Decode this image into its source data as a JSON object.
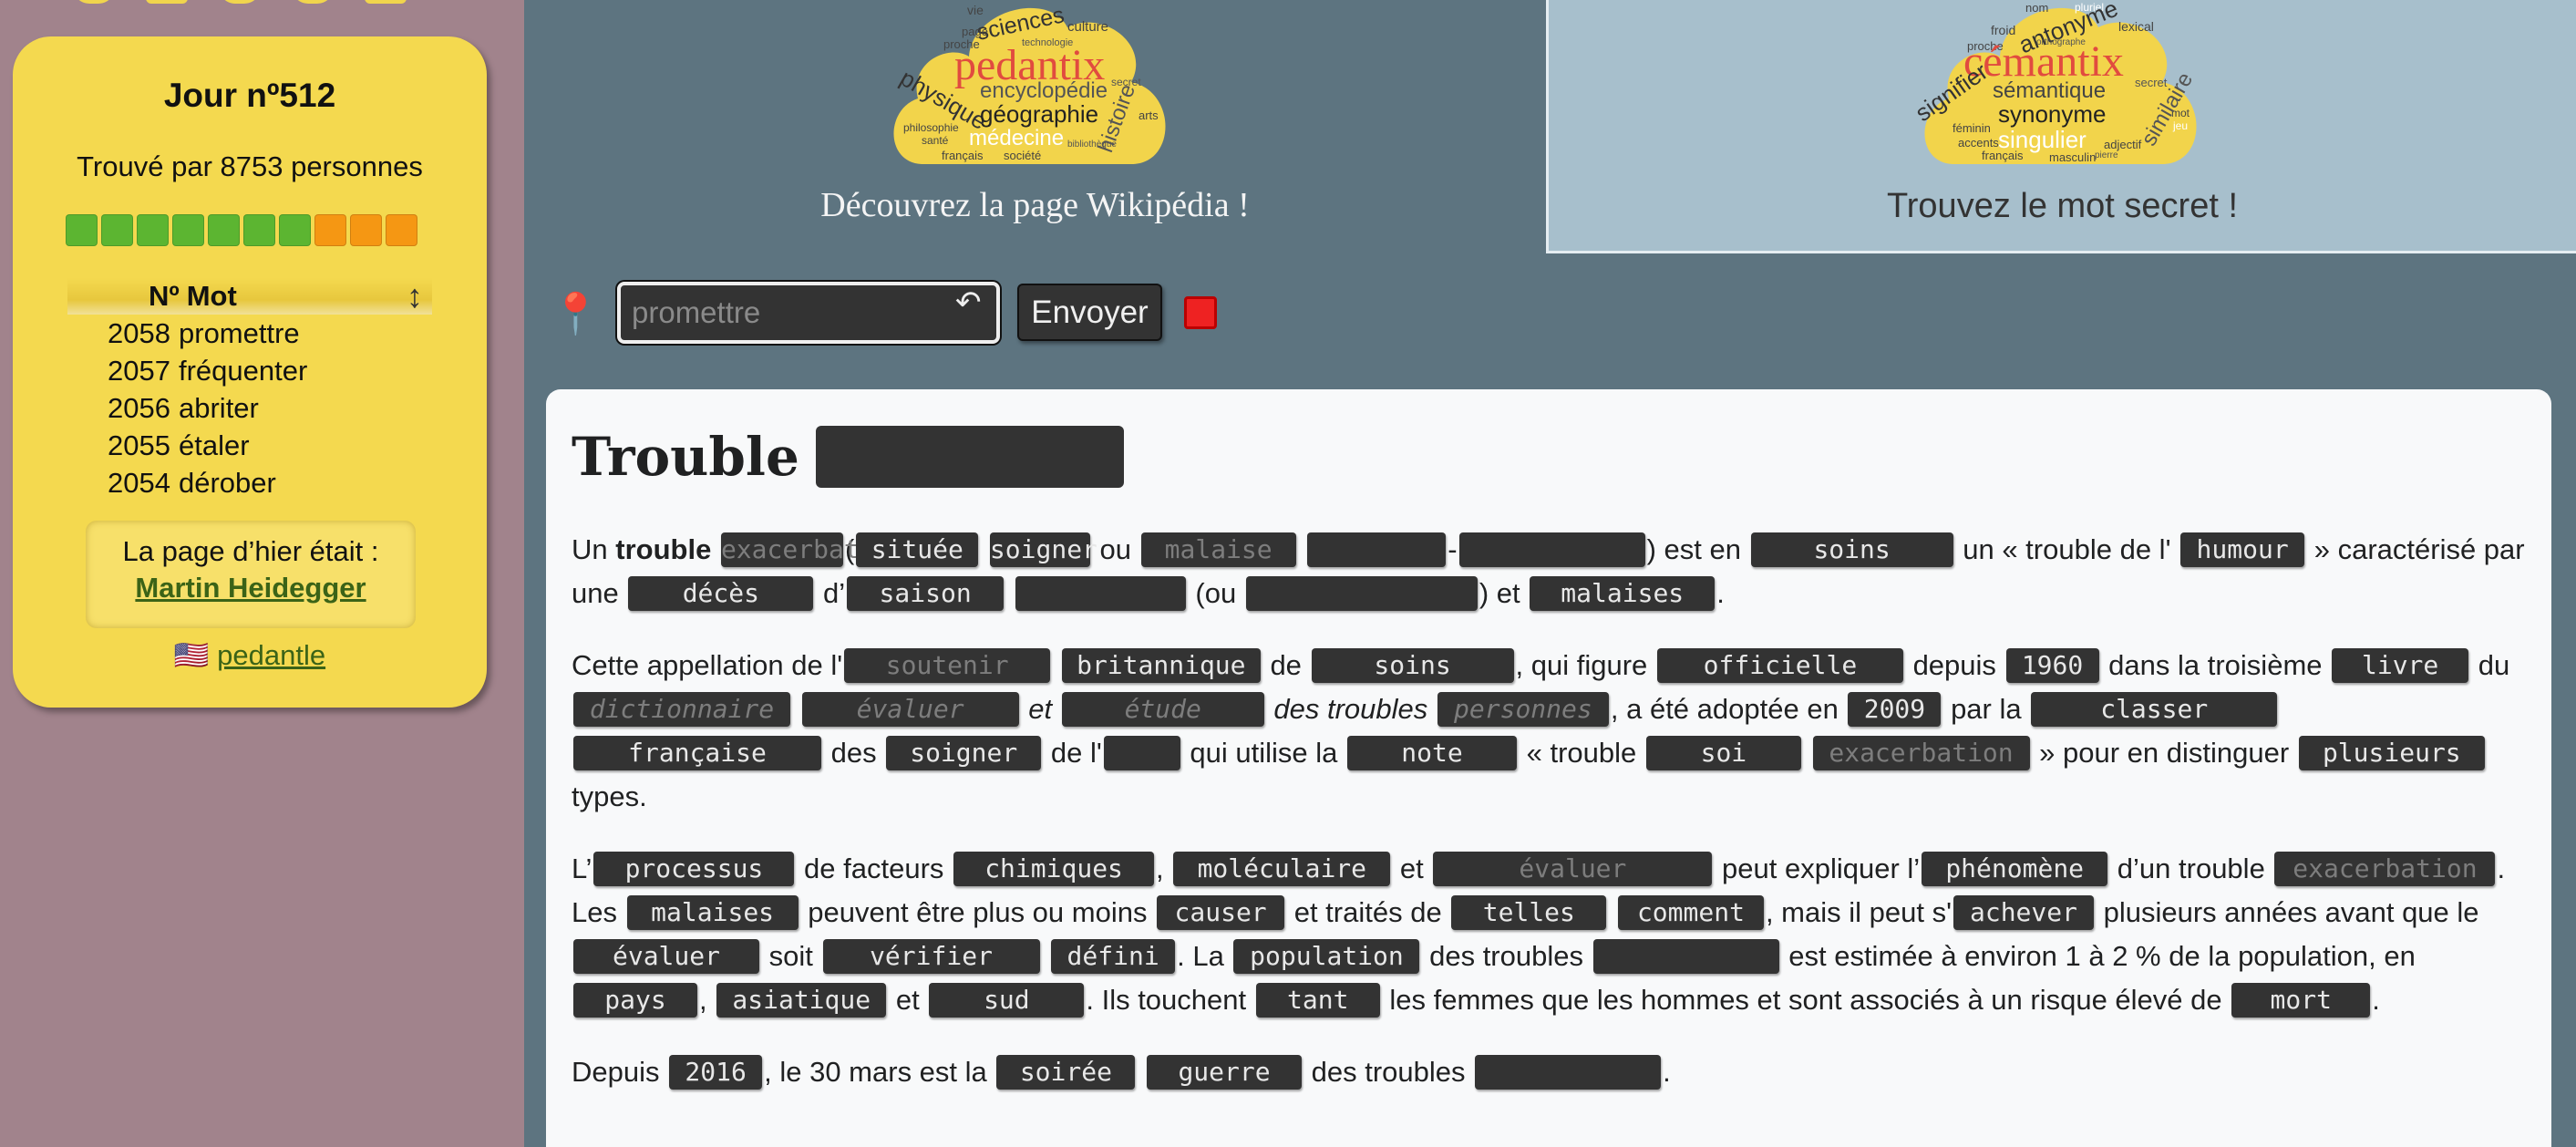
{
  "sidebar": {
    "day_title": "Jour nº512",
    "found_by": "Trouvé par 8753 personnes",
    "progress": [
      "green",
      "green",
      "green",
      "green",
      "green",
      "green",
      "green",
      "orange",
      "orange",
      "orange"
    ],
    "colors": {
      "green": "#5cb531",
      "orange": "#f59713",
      "panel": "#f4d94f"
    },
    "table": {
      "col_num": "Nº",
      "col_word": "Mot",
      "rows": [
        {
          "num": "2058",
          "word": "promettre"
        },
        {
          "num": "2057",
          "word": "fréquenter"
        },
        {
          "num": "2056",
          "word": "abriter"
        },
        {
          "num": "2055",
          "word": "étaler"
        },
        {
          "num": "2054",
          "word": "dérober"
        }
      ]
    },
    "yesterday_label": "La page d’hier était :",
    "yesterday_link": "Martin Heidegger",
    "flag": "🇺🇸",
    "english_link": "pedantle"
  },
  "tabs": {
    "pedantix": {
      "logo_word": "pedantix",
      "cloud_words": [
        "vie",
        "sciences",
        "culture",
        "page",
        "technologie",
        "proche",
        "encyclopédie",
        "secret",
        "physique",
        "géographie",
        "histoire",
        "arts",
        "philosophie",
        "santé",
        "médecine",
        "français",
        "société",
        "bibliothèque"
      ],
      "caption": "Découvrez la page Wikipédia !"
    },
    "cemantix": {
      "logo_word": "cémantix",
      "cloud_words": [
        "nom",
        "pluriel",
        "froid",
        "antonyme",
        "lexical",
        "proche",
        "orthographe",
        "signifier",
        "sémantique",
        "secret",
        "synonyme",
        "mot",
        "féminin",
        "accents",
        "singulier",
        "similaire",
        "jeu",
        "français",
        "masculin",
        "adjectif",
        "pierre"
      ],
      "caption": "Trouvez le mot secret !"
    }
  },
  "guess": {
    "value": "promettre",
    "send_label": "Envoyer"
  },
  "article": {
    "title_word": "Trouble",
    "p1": {
      "a": "Un",
      "b": "trouble",
      "w1": "exacerbation",
      "c": "(",
      "w2": "située",
      "w3": "soigner",
      "d": "ou",
      "w4": "malaise",
      "e": "-",
      "f": ") est en",
      "w5": "soins",
      "g": "un « trouble de l'",
      "w6": "humour",
      "h": "» caractérisé par une",
      "w7": "décès",
      "i": "d’",
      "w8": "saison",
      "j": "(ou",
      "k": ") et",
      "w9": "malaises",
      "l": "."
    },
    "p2": {
      "a": "Cette appellation de l'",
      "w1": "soutenir",
      "w2": "britannique",
      "b": "de",
      "w3": "soins",
      "c": ", qui figure",
      "w4": "officielle",
      "d": "depuis",
      "w5": "1960",
      "e": "dans la troisième",
      "w6": "livre",
      "f": "du",
      "w7": "dictionnaire",
      "w8": "évaluer",
      "g": "et",
      "w9": "étude",
      "h": "des troubles",
      "w10": "personnes",
      "i": ", a été adoptée en",
      "w11": "2009",
      "j": "par la",
      "w12": "classer",
      "w13": "française",
      "k": "des",
      "w14": "soigner",
      "l": "de l'",
      "m": "qui utilise la",
      "w15": "note",
      "n": "« trouble",
      "w16": "soi",
      "w17": "exacerbation",
      "o": "» pour en distinguer",
      "w18": "plusieurs",
      "p": "types."
    },
    "p3": {
      "a": "L’",
      "w1": "processus",
      "b": "de facteurs",
      "w2": "chimiques",
      "c": ",",
      "w3": "moléculaire",
      "d": "et",
      "w4": "évaluer",
      "e": "peut expliquer l’",
      "w5": "phénomène",
      "f": "d’un trouble",
      "w6": "exacerbation",
      "g": ".",
      "h": "Les",
      "w7": "malaises",
      "i": "peuvent être plus ou moins",
      "w8": "causer",
      "j": "et traités de",
      "w9": "telles",
      "w10": "comment",
      "k": ", mais il peut s'",
      "w11": "achever",
      "l": "plusieurs années avant que le",
      "w12": "évaluer",
      "m": "soit",
      "w13": "vérifier",
      "w14": "défini",
      "n": ". La",
      "w15": "population",
      "o": "des troubles",
      "p": "est estimée à environ 1 à 2 % de la population, en",
      "w16": "pays",
      "q": ",",
      "w17": "asiatique",
      "r": "et",
      "w18": "sud",
      "s": ". Ils touchent",
      "w19": "tant",
      "t": "les femmes que les hommes et sont associés à un risque élevé de",
      "w20": "mort",
      "u": "."
    },
    "p4": {
      "a": "Depuis",
      "w1": "2016",
      "b": ", le 30 mars est la",
      "w2": "soirée",
      "w3": "guerre",
      "c": "des troubles",
      "d": "."
    }
  }
}
